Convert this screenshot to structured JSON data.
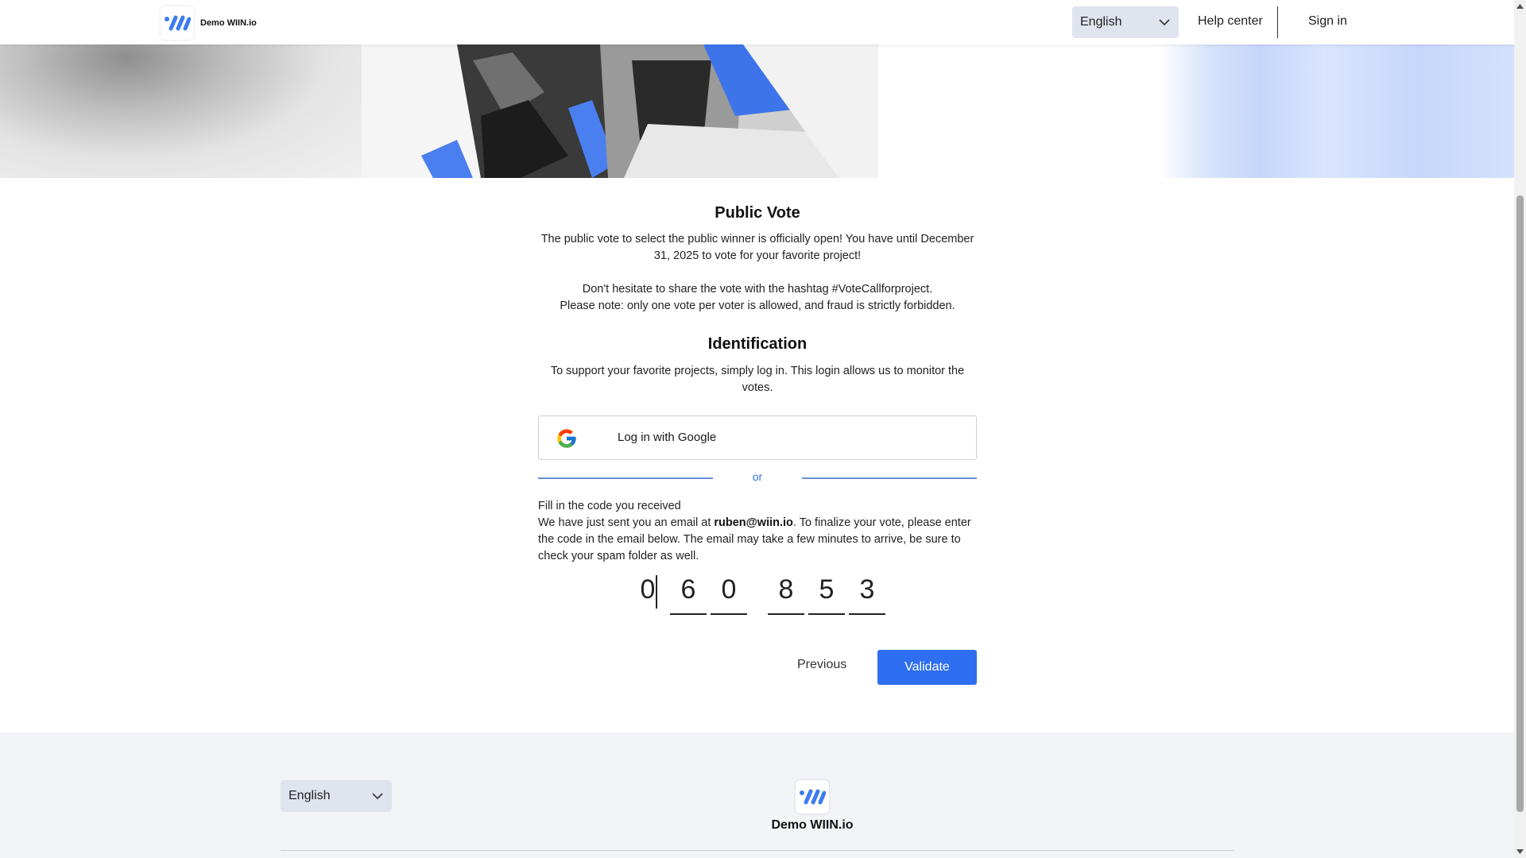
{
  "header": {
    "brand_name": "Demo WIIN.io",
    "language": "English",
    "help_center": "Help center",
    "sign_in": "Sign in"
  },
  "public_vote": {
    "title": "Public Vote",
    "paragraph1": "The public vote to select the public winner is officially open! You have until December 31, 2025 to vote for your favorite project!",
    "paragraph2_line1": "Don't hesitate to share the vote with the hashtag #VoteCallforproject.",
    "paragraph2_line2": "Please note: only one vote per voter is allowed, and fraud is strictly forbidden."
  },
  "identification": {
    "title": "Identification",
    "description": "To support your favorite projects, simply log in. This login allows us to monitor the votes.",
    "google_button": "Log in with Google",
    "or": "or",
    "fill_code_label": "Fill in the code you received",
    "email_prefix": "We have just sent you an email at ",
    "email": "ruben@wiin.io",
    "email_suffix": ". To finalize your vote, please enter the code in the email below. The email may take a few minutes to arrive, be sure to check your spam folder as well.",
    "code_digits": [
      "0",
      "6",
      "0",
      "8",
      "5",
      "3"
    ]
  },
  "actions": {
    "previous": "Previous",
    "validate": "Validate"
  },
  "footer": {
    "language": "English",
    "brand_name": "Demo WIIN.io"
  },
  "colors": {
    "accent": "#2d6ff0",
    "logo_blue": "#3d7cf0",
    "footer_bg": "#f2f4f7",
    "select_bg": "#dfe4ee"
  }
}
